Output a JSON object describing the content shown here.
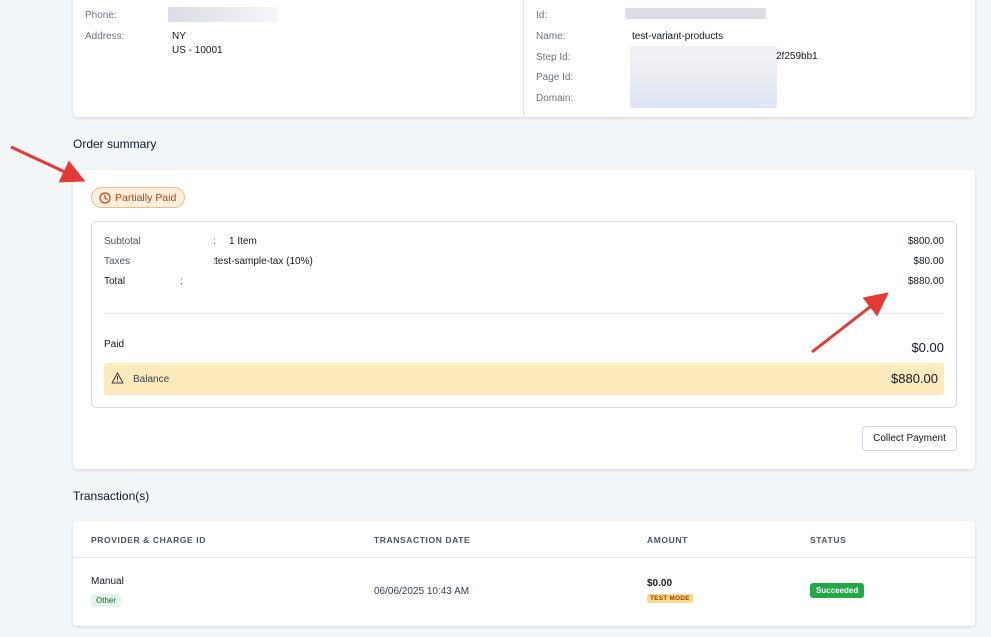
{
  "customer": {
    "phone_label": "Phone:",
    "address_label": "Address:",
    "address_line1": "NY",
    "address_line2": "US - 10001"
  },
  "funnel": {
    "id_label": "Id:",
    "name_label": "Name:",
    "name_value": "test-variant-products",
    "step_id_label": "Step Id:",
    "step_id_visible": "2f259bb1",
    "page_id_label": "Page Id:",
    "domain_label": "Domain:"
  },
  "order_summary": {
    "title": "Order summary",
    "status_badge": "Partially Paid",
    "subtotal_label": "Subtotal",
    "subtotal_desc": "1 Item",
    "subtotal_amount": "$800.00",
    "taxes_label": "Taxes",
    "taxes_desc": "test-sample-tax (10%)",
    "taxes_amount": "$80.00",
    "total_label": "Total",
    "total_amount": "$880.00",
    "paid_label": "Paid",
    "paid_amount": "$0.00",
    "balance_label": "Balance",
    "balance_amount": "$880.00",
    "collect_button": "Collect Payment",
    "colon": ":"
  },
  "transactions": {
    "title": "Transaction(s)",
    "columns": [
      "PROVIDER & CHARGE ID",
      "TRANSACTION DATE",
      "AMOUNT",
      "STATUS"
    ],
    "rows": [
      {
        "provider": "Manual",
        "provider_tag": "Other",
        "date": "06/06/2025 10:43 AM",
        "amount": "$0.00",
        "mode_tag": "TEST MODE",
        "status": "Succeeded"
      }
    ]
  },
  "colors": {
    "partial_badge": "#c2410c",
    "balance_bg": "#fdebbd",
    "success": "#22a847",
    "annotation_arrow": "#e53935"
  },
  "icons": [
    "clock-icon",
    "warning-icon",
    "arrow-annotation"
  ]
}
